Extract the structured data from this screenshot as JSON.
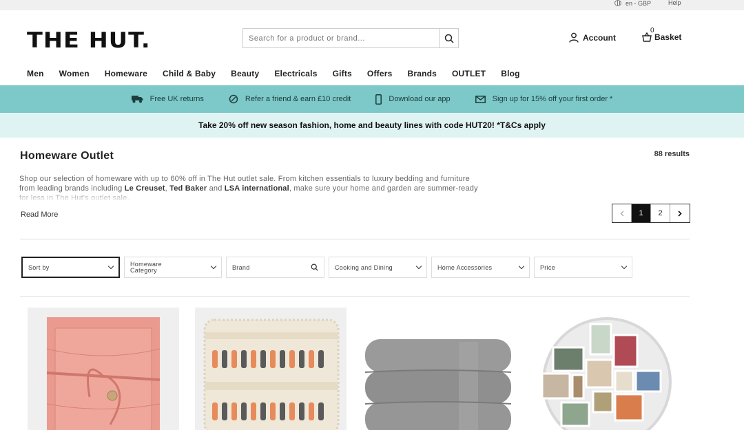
{
  "topbar": {
    "locale": "en - GBP",
    "help": "Help"
  },
  "header": {
    "logo": "THE HUT.",
    "search_placeholder": "Search for a product or brand...",
    "account": "Account",
    "basket": "Basket",
    "basket_count": "0"
  },
  "nav": [
    "Men",
    "Women",
    "Homeware",
    "Child & Baby",
    "Beauty",
    "Electricals",
    "Gifts",
    "Offers",
    "Brands",
    "OUTLET",
    "Blog"
  ],
  "benefits": [
    {
      "icon": "truck-icon",
      "text": "Free UK returns"
    },
    {
      "icon": "refer-icon",
      "text": "Refer a friend & earn £10 credit"
    },
    {
      "icon": "phone-icon",
      "text": "Download our app"
    },
    {
      "icon": "mail-icon",
      "text": "Sign up for 15% off your first order *"
    }
  ],
  "promo": "Take 20% off new season fashion, home and beauty lines with code HUT20! *T&Cs apply",
  "page": {
    "title": "Homeware Outlet",
    "results": "88 results",
    "desc_1": "Shop our selection of homeware with up to 60% off in The Hut outlet sale. From kitchen essentials to luxury bedding and furniture from leading brands including ",
    "brand_1": "Le Creuset",
    "sep_1": ", ",
    "brand_2": "Ted Baker",
    "sep_2": " and ",
    "brand_3": "LSA international",
    "desc_2": ", make sure your home and garden are summer-ready for less in The Hut's outlet sale.",
    "read_more": "Read More"
  },
  "pagination": {
    "pages": [
      "1",
      "2"
    ],
    "current": "1"
  },
  "filters": {
    "sort": "Sort by",
    "category_1": "Homeware",
    "category_2": "Category",
    "brand": "Brand",
    "cooking": "Cooking and Dining",
    "accessories": "Home Accessories",
    "price": "Price"
  },
  "colors": {
    "benefits_bg": "#7dc8c8",
    "promo_bg": "#e0f3f3",
    "pager_active": "#111111"
  }
}
